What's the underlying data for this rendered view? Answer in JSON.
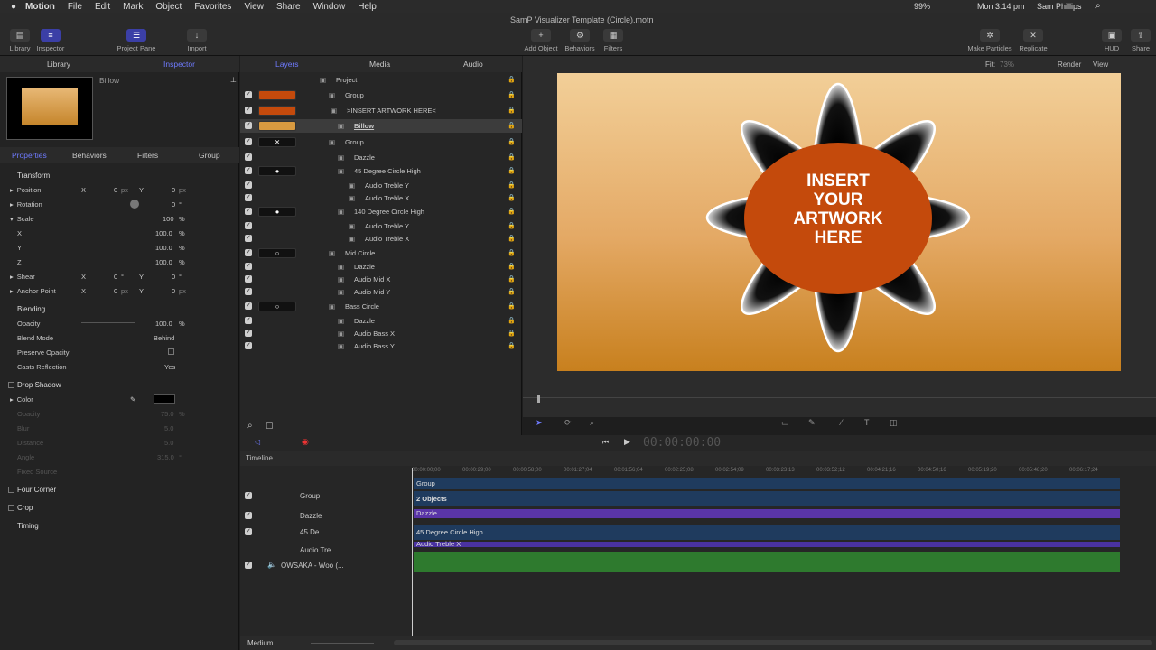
{
  "menubar": {
    "app": "Motion",
    "items": [
      "File",
      "Edit",
      "Mark",
      "Object",
      "Favorites",
      "View",
      "Share",
      "Window",
      "Help"
    ],
    "title": "SamP Visualizer Template (Circle).motn",
    "battery": "99%",
    "clock": "Mon 3:14 pm",
    "user": "Sam Phillips"
  },
  "toolbar": {
    "library": "Library",
    "inspector": "Inspector",
    "project_pane": "Project Pane",
    "import": "Import",
    "add_object": "Add Object",
    "behaviors": "Behaviors",
    "filters": "Filters",
    "make_particles": "Make Particles",
    "replicate": "Replicate",
    "hud": "HUD",
    "share": "Share"
  },
  "left": {
    "tab_library": "Library",
    "tab_inspector": "Inspector",
    "preview_name": "Billow",
    "subtabs": [
      "Properties",
      "Behaviors",
      "Filters",
      "Group"
    ],
    "transform": "Transform",
    "position": {
      "label": "Position",
      "x": "0",
      "y": "0",
      "unit": "px"
    },
    "rotation": {
      "label": "Rotation",
      "value": "0",
      "unit": "°"
    },
    "scale": {
      "label": "Scale",
      "value": "100",
      "unit": "%",
      "x": "100.0",
      "y": "100.0",
      "z": "100.0",
      "xl": "X",
      "yl": "Y",
      "zl": "Z"
    },
    "shear": {
      "label": "Shear",
      "x": "0",
      "y": "0",
      "unit": "°"
    },
    "anchor": {
      "label": "Anchor Point",
      "x": "0",
      "y": "0",
      "unit": "px"
    },
    "blending": "Blending",
    "opacity": {
      "label": "Opacity",
      "value": "100.0",
      "unit": "%"
    },
    "blend_mode": {
      "label": "Blend Mode",
      "value": "Behind"
    },
    "preserve": "Preserve Opacity",
    "casts": {
      "label": "Casts Reflection",
      "value": "Yes"
    },
    "drop_shadow": "Drop Shadow",
    "ds_color": "Color",
    "ds_opacity": {
      "label": "Opacity",
      "value": "75.0",
      "unit": "%"
    },
    "ds_blur": {
      "label": "Blur",
      "value": "5.0"
    },
    "ds_distance": {
      "label": "Distance",
      "value": "5.0"
    },
    "ds_angle": {
      "label": "Angle",
      "value": "315.0",
      "unit": "°"
    },
    "ds_fixed": "Fixed Source",
    "four_corner": "Four Corner",
    "crop": "Crop",
    "timing": "Timing",
    "xl": "X",
    "yl": "Y"
  },
  "layers": {
    "tab_layers": "Layers",
    "tab_media": "Media",
    "tab_audio": "Audio",
    "rows": [
      "Project",
      "Group",
      ">INSERT ARTWORK HERE<",
      "Billow",
      "Group",
      "Dazzle",
      "45 Degree Circle High",
      "Audio Treble Y",
      "Audio Treble X",
      "140 Degree Circle High",
      "Audio Treble Y",
      "Audio Treble X",
      "Mid Circle",
      "Dazzle",
      "Audio Mid X",
      "Audio Mid Y",
      "Bass Circle",
      "Dazzle",
      "Audio Bass X",
      "Audio Bass Y"
    ]
  },
  "canvas": {
    "fit": "Fit:",
    "fit_value": "73%",
    "render": "Render",
    "view": "View",
    "artwork": [
      "INSERT",
      "YOUR",
      "ARTWORK",
      "HERE"
    ],
    "accent": "#c44a0c"
  },
  "timeline": {
    "label": "Timeline",
    "timecode": "00:00:00:00",
    "ruler": [
      "00:00:00;00",
      "00:00:29;00",
      "00:00:58;00",
      "00:01:27;04",
      "00:01:56;04",
      "00:02:25;08",
      "00:02:54;09",
      "00:03:23;13",
      "00:03:52;12",
      "00:04:21;16",
      "00:04:50;16",
      "00:05:19;20",
      "00:05:48;20",
      "00:06:17;24"
    ],
    "rows": [
      "Group",
      "Dazzle",
      "45 De...",
      "Audio Tre..."
    ],
    "bars": [
      "Group",
      "2 Objects",
      "Dazzle",
      "45 Degree Circle High",
      "Audio Treble X"
    ],
    "audio": "OWSAKA - Woo (...",
    "zoom": "Medium"
  }
}
